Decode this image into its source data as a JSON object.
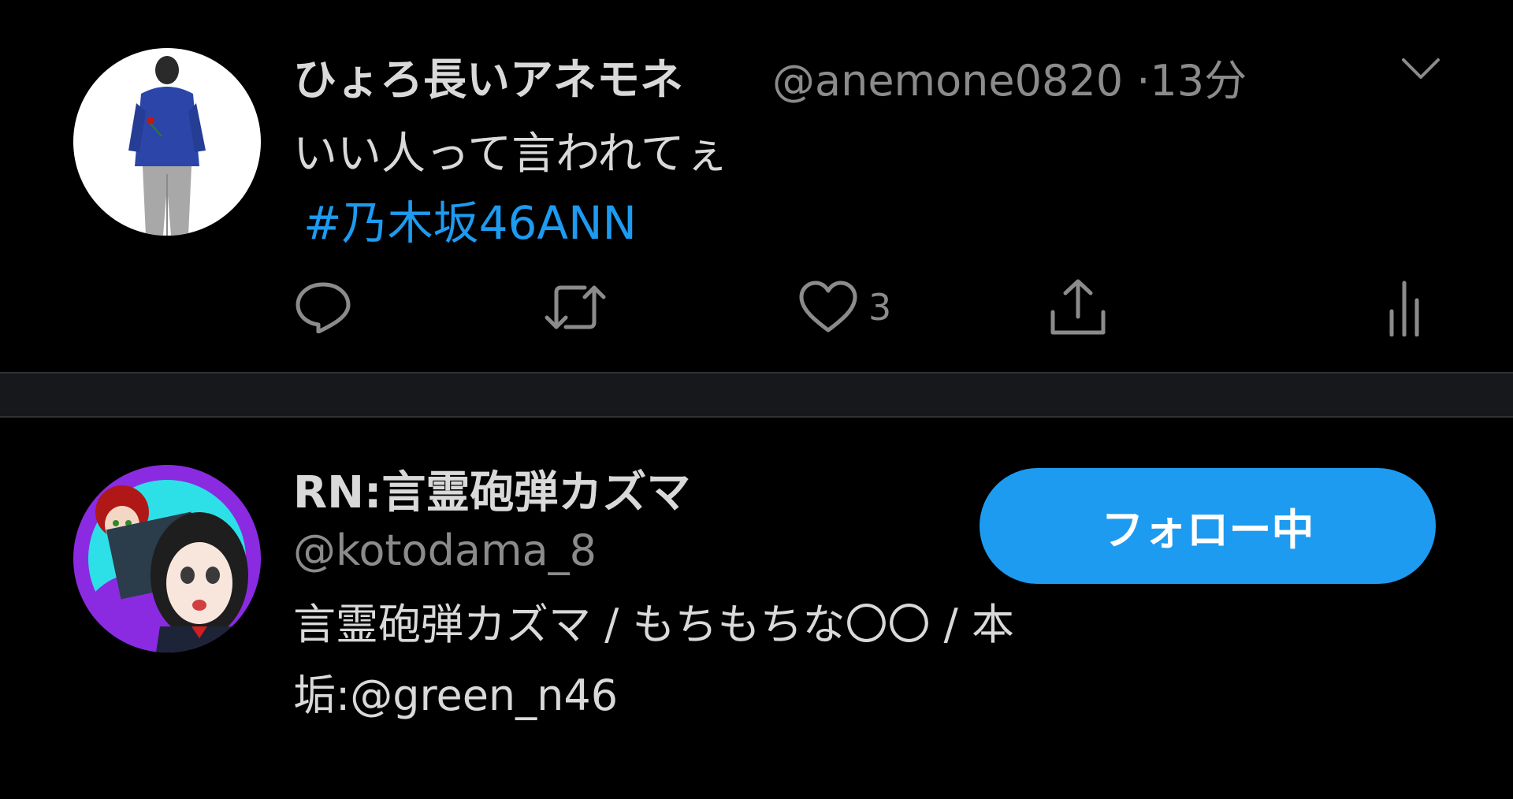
{
  "tweet": {
    "display_name": "ひょろ長いアネモネ",
    "handle": "@anemone0820",
    "separator": "·",
    "time": "13分",
    "text": "いい人って言われてぇ",
    "hashtag": "#乃木坂46ANN",
    "like_count": "3",
    "icons": {
      "reply": "reply-icon",
      "retweet": "retweet-icon",
      "like": "heart-icon",
      "share": "share-icon",
      "analytics": "analytics-icon",
      "menu": "chevron-down-icon"
    }
  },
  "user": {
    "display_name": "RN:言霊砲弾カズマ",
    "handle": "@kotodama_8",
    "follow_label": "フォロー中",
    "bio_line1": "言霊砲弾カズマ / もちもちな〇〇 / 本",
    "bio_line2": "垢:@green_n46"
  },
  "colors": {
    "background": "#000000",
    "accent": "#1d9bf0",
    "text": "#d9d9d9",
    "muted": "#8b8b8b",
    "separator": "#16181c"
  }
}
